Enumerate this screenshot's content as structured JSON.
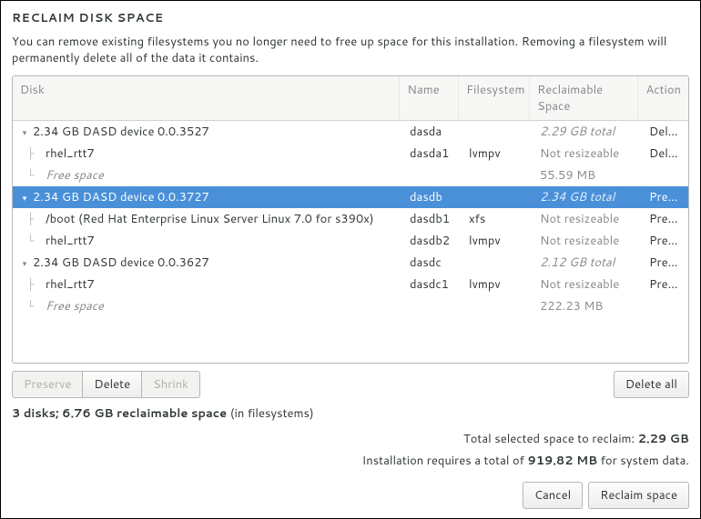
{
  "title": "RECLAIM DISK SPACE",
  "description": "You can remove existing filesystems you no longer need to free up space for this installation.  Removing a filesystem will permanently delete all of the data it contains.",
  "columns": {
    "disk": "Disk",
    "name": "Name",
    "filesystem": "Filesystem",
    "reclaimable": "Reclaimable Space",
    "action": "Action"
  },
  "rows": [
    {
      "type": "disk",
      "indent": 0,
      "expander": true,
      "disk": "2.34 GB DASD device 0.0.3527",
      "name": "dasda",
      "fs": "",
      "recl": "2.29 GB total",
      "reclItalic": true,
      "action": "Delete",
      "selected": false,
      "diskItalic": false
    },
    {
      "type": "part",
      "indent": 1,
      "expander": false,
      "disk": "rhel_rtt7",
      "name": "dasda1",
      "fs": "lvmpv",
      "recl": "Not resizeable",
      "reclItalic": false,
      "action": "Delete",
      "selected": false,
      "diskItalic": false
    },
    {
      "type": "free",
      "indent": 1,
      "expander": false,
      "disk": "Free space",
      "name": "",
      "fs": "",
      "recl": "55.59 MB",
      "reclItalic": false,
      "action": "",
      "selected": false,
      "diskItalic": true
    },
    {
      "type": "disk",
      "indent": 0,
      "expander": true,
      "disk": "2.34 GB DASD device 0.0.3727",
      "name": "dasdb",
      "fs": "",
      "recl": "2.34 GB total",
      "reclItalic": true,
      "action": "Preserve",
      "selected": true,
      "diskItalic": false
    },
    {
      "type": "part",
      "indent": 1,
      "expander": false,
      "disk": "/boot (Red Hat Enterprise Linux Server Linux 7.0 for s390x)",
      "name": "dasdb1",
      "fs": "xfs",
      "recl": "Not resizeable",
      "reclItalic": false,
      "action": "Preserve",
      "selected": false,
      "diskItalic": false
    },
    {
      "type": "part",
      "indent": 1,
      "expander": false,
      "disk": "rhel_rtt7",
      "name": "dasdb2",
      "fs": "lvmpv",
      "recl": "Not resizeable",
      "reclItalic": false,
      "action": "Preserve",
      "selected": false,
      "diskItalic": false
    },
    {
      "type": "disk",
      "indent": 0,
      "expander": true,
      "disk": "2.34 GB DASD device 0.0.3627",
      "name": "dasdc",
      "fs": "",
      "recl": "2.12 GB total",
      "reclItalic": true,
      "action": "Preserve",
      "selected": false,
      "diskItalic": false
    },
    {
      "type": "part",
      "indent": 1,
      "expander": false,
      "disk": "rhel_rtt7",
      "name": "dasdc1",
      "fs": "lvmpv",
      "recl": "Not resizeable",
      "reclItalic": false,
      "action": "Preserve",
      "selected": false,
      "diskItalic": false
    },
    {
      "type": "free",
      "indent": 1,
      "expander": false,
      "disk": "Free space",
      "name": "",
      "fs": "",
      "recl": "222.23 MB",
      "reclItalic": false,
      "action": "",
      "selected": false,
      "diskItalic": true
    }
  ],
  "buttons": {
    "preserve": "Preserve",
    "delete": "Delete",
    "shrink": "Shrink",
    "deleteAll": "Delete all",
    "cancel": "Cancel",
    "reclaim": "Reclaim space"
  },
  "summary": {
    "prefix": "3 disks; 6.76 GB reclaimable space",
    "suffix": " (in filesystems)"
  },
  "totals": {
    "selectedLabel": "Total selected space to reclaim: ",
    "selectedValue": "2.29 GB",
    "requiresPrefix": "Installation requires a total of ",
    "requiresValue": "919.82 MB",
    "requiresSuffix": " for system data."
  }
}
